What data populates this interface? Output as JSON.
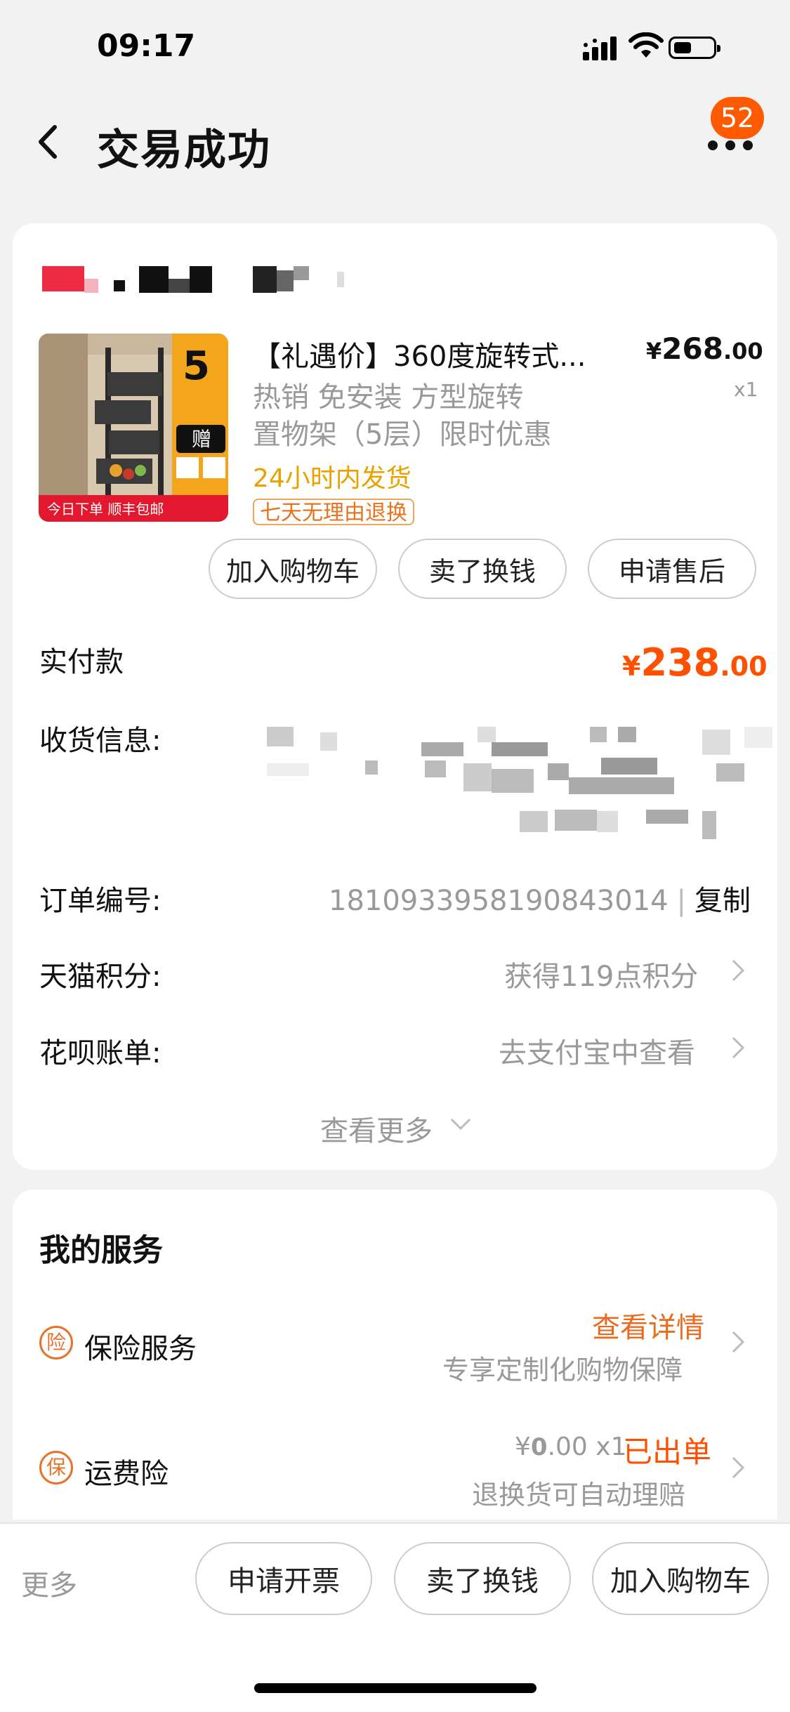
{
  "status_bar": {
    "time": "09:17"
  },
  "header": {
    "title": "交易成功",
    "badge_count": "52"
  },
  "product": {
    "title": "【礼遇价】360度旋转式...",
    "price_currency": "¥",
    "price_int": "268",
    "price_dec": ".00",
    "quantity": "x1",
    "spec_line1": "热销 免安装 方型旋转",
    "spec_line2": "置物架（5层）限时优惠",
    "shipping": "24小时内发货",
    "return_tag": "七天无理由退换",
    "image_text": {
      "badge_number": "5",
      "gift": "赠",
      "banner": "今日下单 顺丰包邮"
    }
  },
  "product_actions": {
    "add_cart": "加入购物车",
    "sell": "卖了换钱",
    "after_sale": "申请售后"
  },
  "payment": {
    "label": "实付款",
    "currency": "¥",
    "amount_int": "238",
    "amount_dec": ".00"
  },
  "address": {
    "label": "收货信息:"
  },
  "order": {
    "label": "订单编号:",
    "number": "1810933958190843014",
    "separator": "|",
    "copy": "复制"
  },
  "points": {
    "label": "天猫积分:",
    "value": "获得119点积分"
  },
  "bill": {
    "label": "花呗账单:",
    "value": "去支付宝中查看"
  },
  "see_more": "查看更多",
  "services": {
    "title": "我的服务",
    "insurance": {
      "icon_char": "险",
      "label": "保险服务",
      "action": "查看详情",
      "desc": "专享定制化购物保障"
    },
    "freight": {
      "icon_char": "保",
      "label": "运费险",
      "price_currency": "¥",
      "price_int": "0",
      "price_dec": ".00",
      "qty": "x1",
      "status": "已出单",
      "desc": "退换货可自动理赔"
    }
  },
  "bottom_bar": {
    "more": "更多",
    "invoice": "申请开票",
    "sell": "卖了换钱",
    "add_cart": "加入购物车"
  },
  "colors": {
    "accent": "#ff5000",
    "badge": "#ff5a00",
    "service_orange": "#e8722a"
  }
}
